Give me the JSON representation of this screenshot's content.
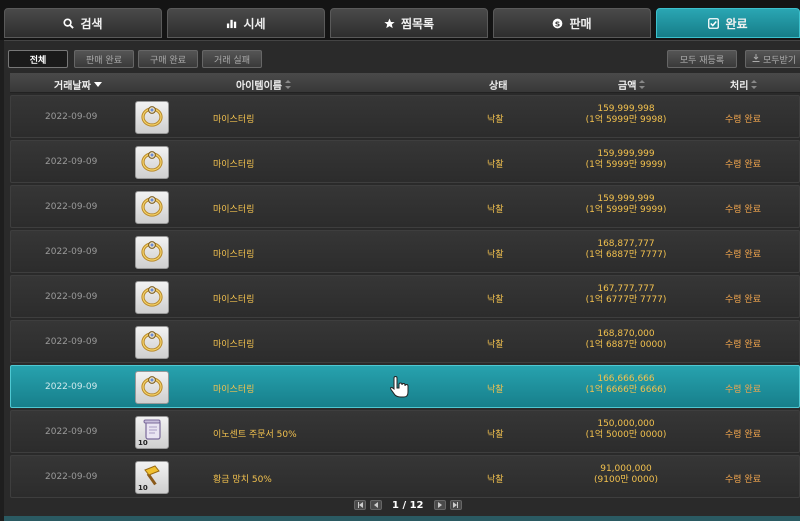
{
  "tabs": [
    {
      "label": "검색",
      "icon": "search-icon",
      "active": false
    },
    {
      "label": "시세",
      "icon": "chart-icon",
      "active": false
    },
    {
      "label": "찜목록",
      "icon": "star-icon",
      "active": false
    },
    {
      "label": "판매",
      "icon": "coin-icon",
      "active": false
    },
    {
      "label": "완료",
      "icon": "check-icon",
      "active": true
    }
  ],
  "filters": {
    "all": "전체",
    "sell_done": "판매 완료",
    "buy_done": "구매 완료",
    "trade_fail": "거래 실패",
    "relist_all": "모두 재등록",
    "receive_all": "모두받기"
  },
  "columns": {
    "date": "거래날짜",
    "item_name": "아이템이름",
    "status": "상태",
    "amount": "금액",
    "process": "처리"
  },
  "rows": [
    {
      "date": "2022-09-09",
      "item": "마이스터링",
      "item_icon": "ring-icon",
      "status": "낙찰",
      "amount": "159,999,998",
      "amount_kr": "(1억 5999만 9998)",
      "process": "수령 완료",
      "selected": false
    },
    {
      "date": "2022-09-09",
      "item": "마이스터링",
      "item_icon": "ring-icon",
      "status": "낙찰",
      "amount": "159,999,999",
      "amount_kr": "(1억 5999만 9999)",
      "process": "수령 완료",
      "selected": false
    },
    {
      "date": "2022-09-09",
      "item": "마이스터링",
      "item_icon": "ring-icon",
      "status": "낙찰",
      "amount": "159,999,999",
      "amount_kr": "(1억 5999만 9999)",
      "process": "수령 완료",
      "selected": false
    },
    {
      "date": "2022-09-09",
      "item": "마이스터링",
      "item_icon": "ring-icon",
      "status": "낙찰",
      "amount": "168,877,777",
      "amount_kr": "(1억 6887만 7777)",
      "process": "수령 완료",
      "selected": false
    },
    {
      "date": "2022-09-09",
      "item": "마이스터링",
      "item_icon": "ring-icon",
      "status": "낙찰",
      "amount": "167,777,777",
      "amount_kr": "(1억 6777만 7777)",
      "process": "수령 완료",
      "selected": false
    },
    {
      "date": "2022-09-09",
      "item": "마이스터링",
      "item_icon": "ring-icon",
      "status": "낙찰",
      "amount": "168,870,000",
      "amount_kr": "(1억 6887만 0000)",
      "process": "수령 완료",
      "selected": false
    },
    {
      "date": "2022-09-09",
      "item": "마이스터링",
      "item_icon": "ring-icon",
      "status": "낙찰",
      "amount": "166,666,666",
      "amount_kr": "(1억 6666만 6666)",
      "process": "수령 완료",
      "selected": true
    },
    {
      "date": "2022-09-09",
      "item": "이노센트 주문서 50%",
      "item_icon": "scroll-icon",
      "item_badge": "10",
      "status": "낙찰",
      "amount": "150,000,000",
      "amount_kr": "(1억 5000만 0000)",
      "process": "수령 완료",
      "selected": false
    },
    {
      "date": "2022-09-09",
      "item": "황금 망치 50%",
      "item_icon": "hammer-icon",
      "item_badge": "10",
      "status": "낙찰",
      "amount": "91,000,000",
      "amount_kr": "(9100만 0000)",
      "process": "수령 완료",
      "selected": false
    }
  ],
  "pagination": {
    "text": "1 / 12"
  },
  "colors": {
    "accent": "#1f8f9b",
    "gold": "#f2c14e"
  }
}
